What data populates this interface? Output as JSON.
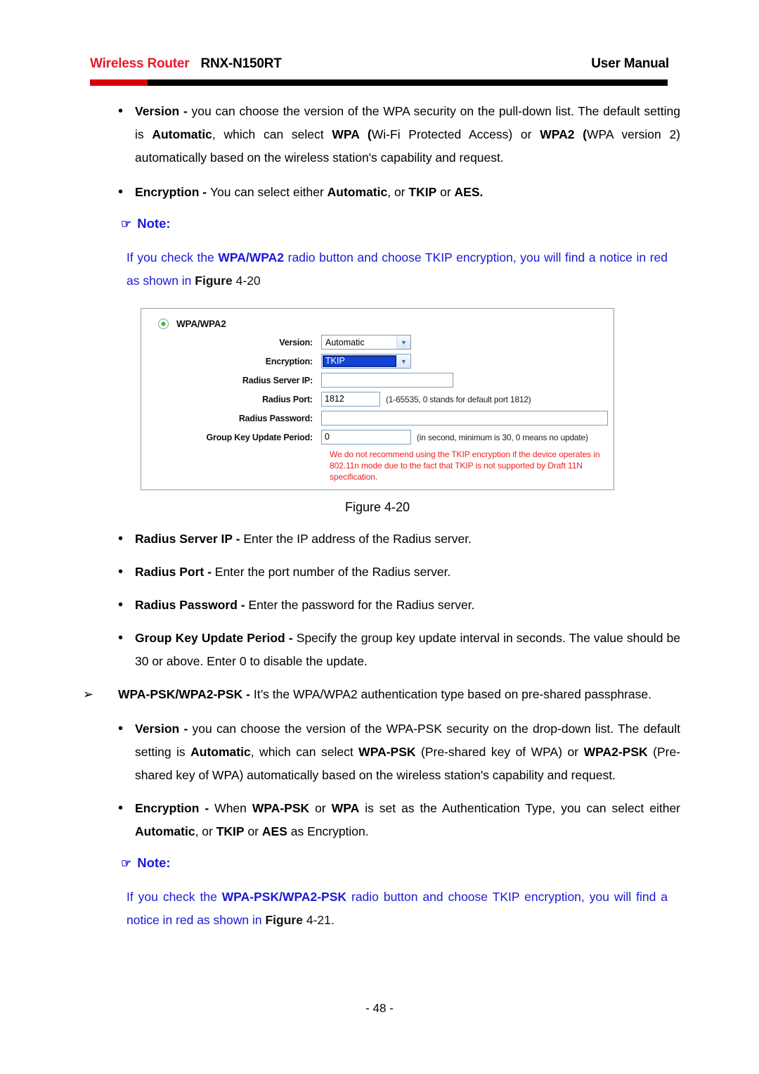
{
  "header": {
    "brand": "Wireless Router",
    "model": "RNX-N150RT",
    "doc_type": "User Manual",
    "rule_red": "#d90000",
    "rule_black": "#000000",
    "brand_color": "#e8192c"
  },
  "body": {
    "version_bullet": {
      "marker": "•",
      "lead": "Version",
      "sep": " - ",
      "text_1": "you can choose the version of the WPA security on the pull-down list. The default setting is ",
      "bold_1": "Automatic",
      "text_2": ", which can select ",
      "bold_2": "WPA (",
      "text_3": "Wi-Fi Protected Access) or ",
      "bold_3": "WPA2 (",
      "text_4": "WPA version 2) automatically based on the wireless station's capability and request."
    },
    "encryption_bullet": {
      "marker": "•",
      "lead": "Encryption",
      "sep": " - ",
      "text_1": "You can select either ",
      "bold_1": "Automatic",
      "text_2": ", or ",
      "bold_2": "TKIP",
      "text_3": " or ",
      "bold_3": "AES."
    },
    "note_1": {
      "hand_icon": "☞",
      "label": "Note:",
      "text_1": "If you check the ",
      "bold_1": "WPA/WPA2",
      "text_2": " radio button and choose TKIP encryption, you will find a notice in red as shown in ",
      "bold_2": "Figure",
      "text_3": " 4-20",
      "color": "#1a18d8"
    },
    "figure_caption": "Figure 4-20",
    "radius_server_ip_bullet": {
      "marker": "•",
      "lead": "Radius Server IP",
      "sep": " - ",
      "text_1": "Enter the IP address of the Radius server."
    },
    "radius_port_bullet": {
      "marker": "•",
      "lead": "Radius Port",
      "sep": " - ",
      "text_1": "Enter the port number of the Radius server."
    },
    "radius_password_bullet": {
      "marker": "•",
      "lead": "Radius Password",
      "sep": " - ",
      "text_1": "Enter the password for the Radius server."
    },
    "group_key_bullet": {
      "marker": "•",
      "lead": "Group Key Update Period",
      "sep": " - ",
      "text_1": "Specify the group key update interval in seconds. The value should be 30 or above. Enter 0 to disable the update."
    },
    "wpa_psk_bullet": {
      "marker": "➢",
      "lead": "WPA-PSK/WPA2-PSK",
      "sep": " - ",
      "text_1": "It’s the WPA/WPA2 authentication type based on pre-shared passphrase."
    },
    "version_psk_bullet": {
      "marker": "•",
      "lead": "Version",
      "sep": " - ",
      "text_1": "you can choose the version of the WPA-PSK security on the drop-down list. The default setting is ",
      "bold_1": "Automatic",
      "text_2": ", which can select ",
      "bold_2": "WPA-PSK",
      "text_3": " (Pre-shared key of WPA) or ",
      "bold_3": "WPA2-PSK",
      "text_4": " (Pre-shared key of WPA) automatically based on the wireless station's capability and request."
    },
    "encryption_psk_bullet": {
      "marker": "•",
      "lead": "Encryption",
      "sep": " - ",
      "text_1": "When ",
      "bold_1": "WPA-PSK",
      "text_2": " or ",
      "bold_2": "WPA",
      "text_3": " is set as the Authentication Type, you can select either ",
      "bold_3": "Automatic",
      "text_4": ", or ",
      "bold_4": "TKIP",
      "text_5": " or ",
      "bold_5": "AES",
      "text_6": " as Encryption."
    },
    "note_2": {
      "hand_icon": "☞",
      "label": "Note:",
      "text_1": "If you check the ",
      "bold_1": "WPA-PSK/WPA2-PSK",
      "text_2": " radio button and choose TKIP encryption, you will find a notice in red as shown in ",
      "bold_2": "Figure",
      "text_3": " 4-21.",
      "color": "#1a18d8"
    }
  },
  "figure": {
    "radio_label": "WPA/WPA2",
    "radio_selected": true,
    "fields": [
      {
        "label": "Version:",
        "type": "select",
        "value": "Automatic",
        "highlighted": false,
        "hint": ""
      },
      {
        "label": "Encryption:",
        "type": "select",
        "value": "TKIP",
        "highlighted": true,
        "hint": ""
      },
      {
        "label": "Radius Server IP:",
        "type": "text",
        "value": "",
        "hint": ""
      },
      {
        "label": "Radius Port:",
        "type": "text",
        "value": "1812",
        "hint": "(1-65535, 0 stands for default port 1812)"
      },
      {
        "label": "Radius Password:",
        "type": "text",
        "value": "",
        "hint": ""
      },
      {
        "label": "Group Key Update Period:",
        "type": "text",
        "value": "0",
        "hint": "(in second, minimum is 30, 0 means no update)"
      }
    ],
    "warning_line_1": "We do not recommend using the TKIP encryption if the device operates in",
    "warning_line_2": "802.11n mode due to the fact that TKIP is not supported by Draft 11N specification.",
    "warning_color": "#f01e1e",
    "dropdown_arrow_icon": "▼"
  },
  "footer": {
    "page_number": "- 48 -"
  }
}
